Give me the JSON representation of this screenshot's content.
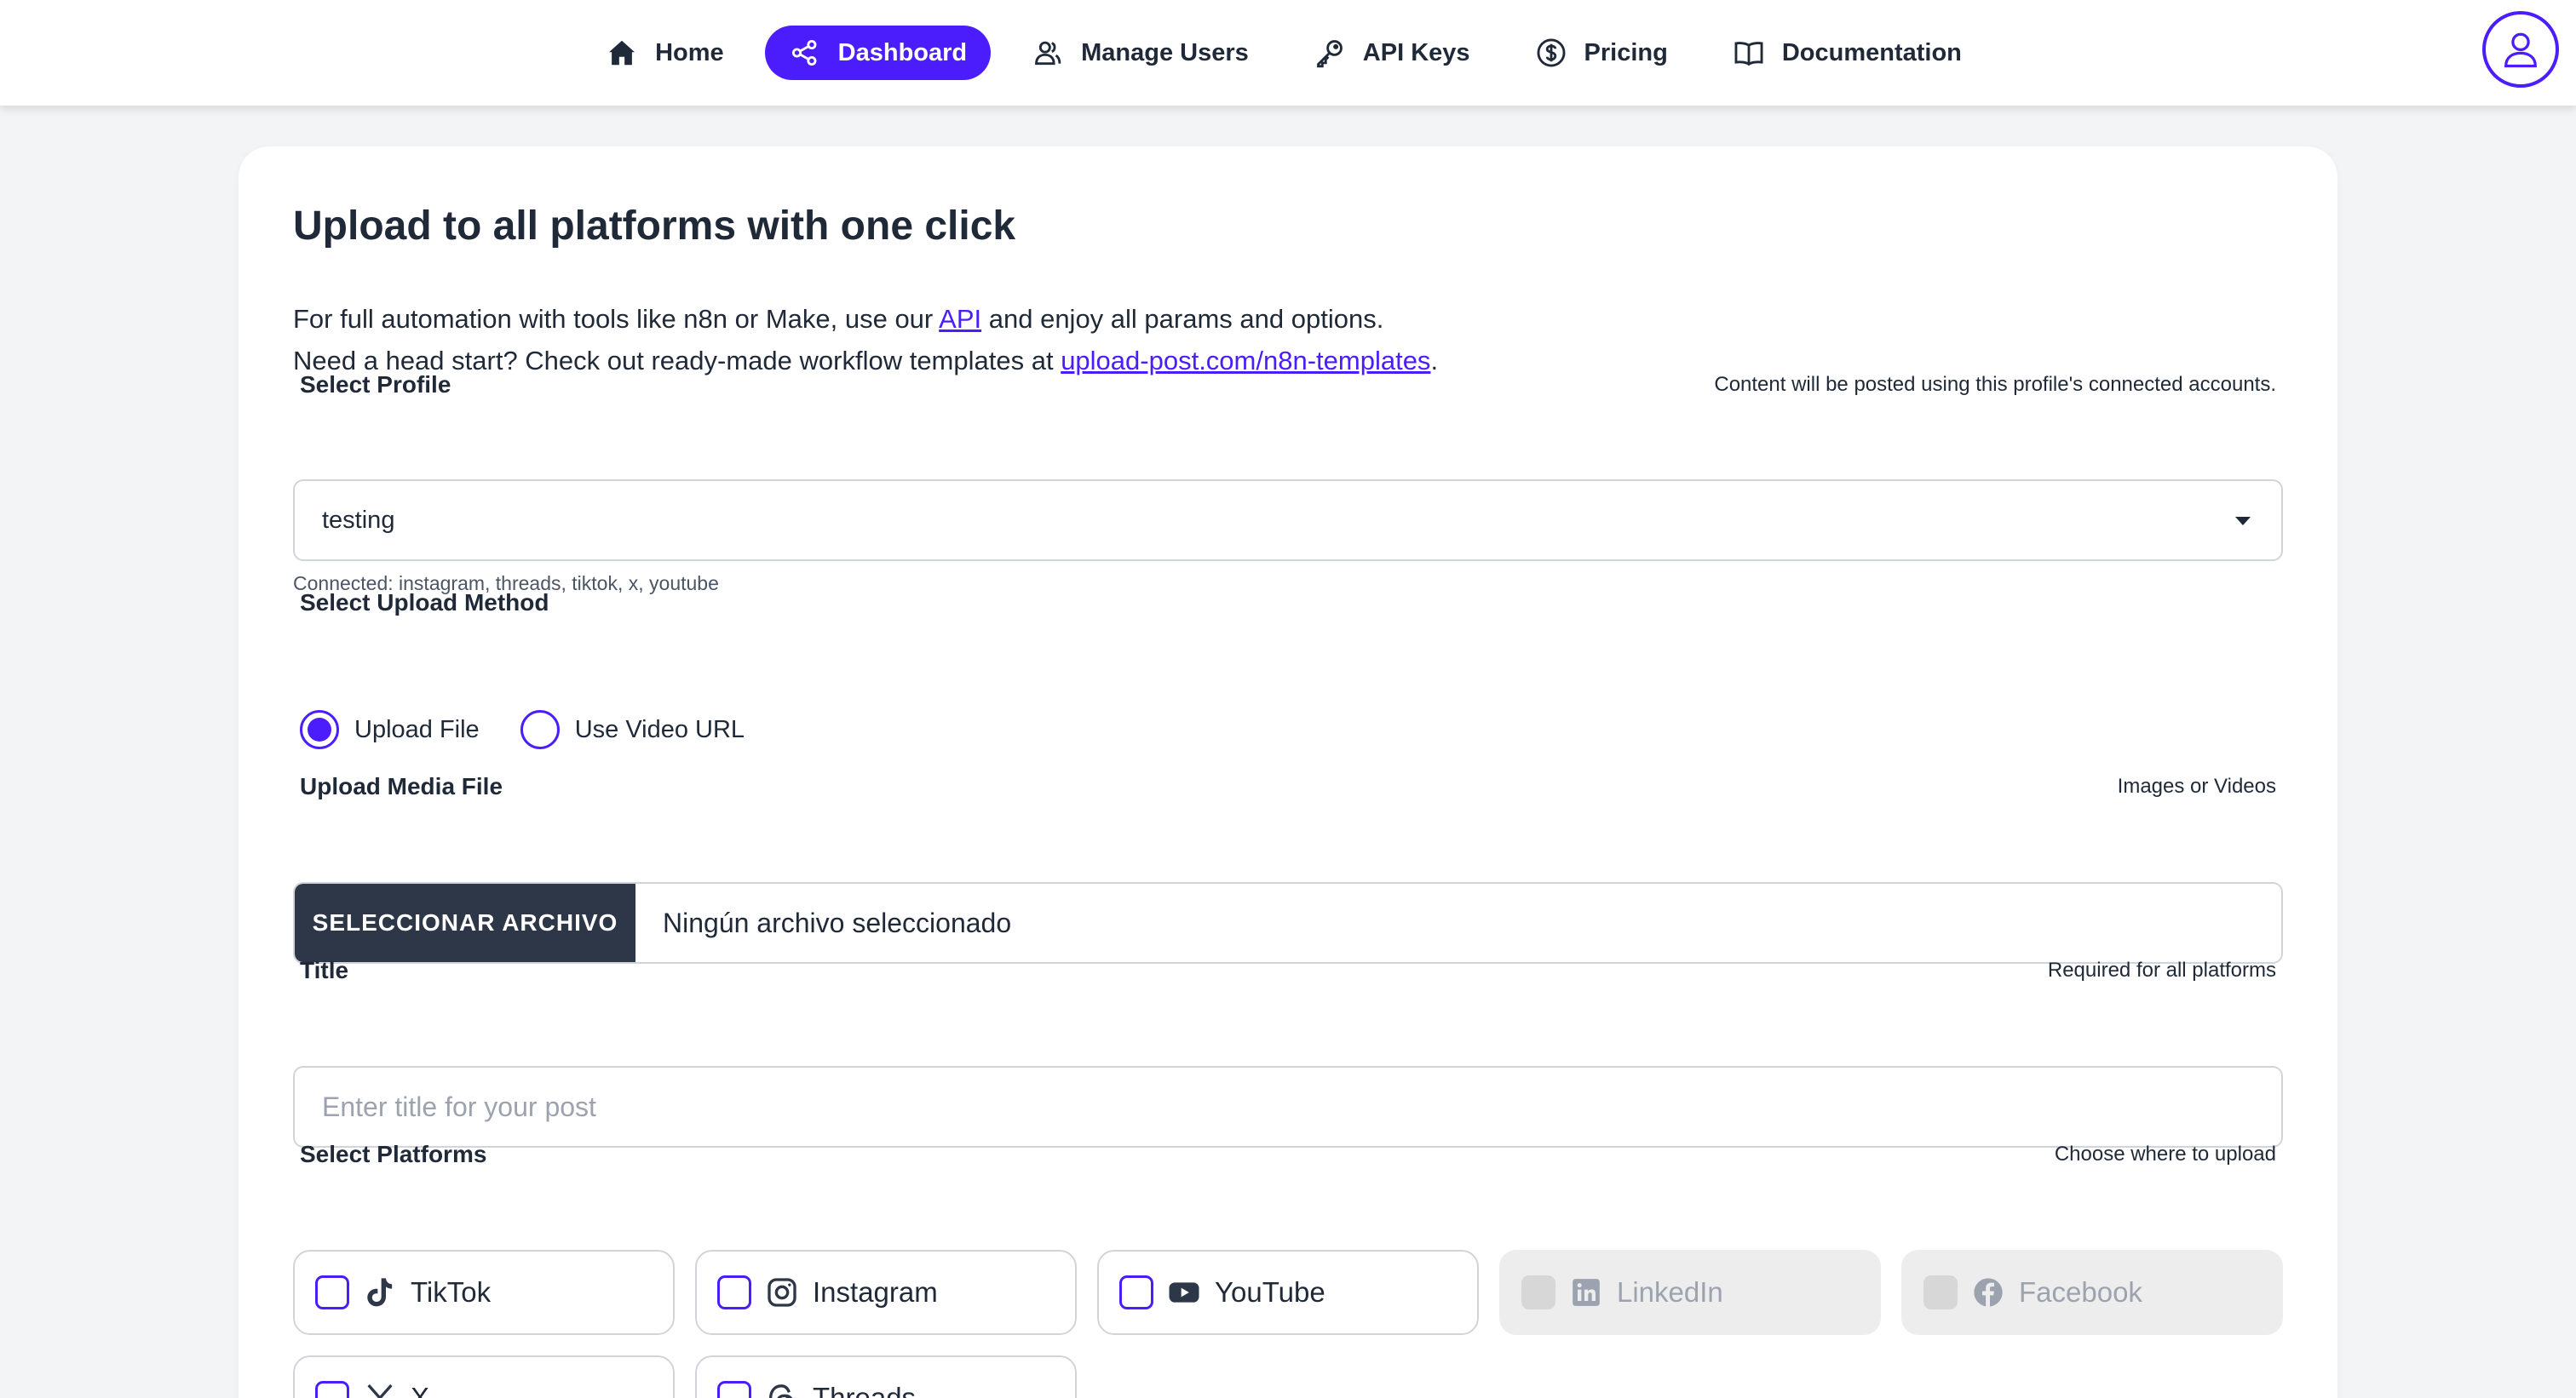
{
  "nav": {
    "items": [
      {
        "label": "Home",
        "icon": "home-icon"
      },
      {
        "label": "Dashboard",
        "icon": "share-icon",
        "active": true
      },
      {
        "label": "Manage Users",
        "icon": "users-icon"
      },
      {
        "label": "API Keys",
        "icon": "key-icon"
      },
      {
        "label": "Pricing",
        "icon": "dollar-icon"
      },
      {
        "label": "Documentation",
        "icon": "book-icon"
      }
    ],
    "avatar_icon": "user-icon"
  },
  "page": {
    "title": "Upload to all platforms with one click",
    "intro_line1_before": "For full automation with tools like n8n or Make, use our ",
    "intro_line1_link": "API",
    "intro_line1_after": " and enjoy all params and options.",
    "intro_line2_before": "Need a head start? Check out ready-made workflow templates at ",
    "intro_line2_link": "upload-post.com/n8n-templates",
    "intro_line2_after": "."
  },
  "profile": {
    "label": "Select Profile",
    "hint": "Content will be posted using this profile's connected accounts.",
    "selected": "testing",
    "connected": "Connected: instagram, threads, tiktok, x, youtube"
  },
  "upload_method": {
    "label": "Select Upload Method",
    "options": [
      {
        "label": "Upload File",
        "selected": true
      },
      {
        "label": "Use Video URL",
        "selected": false
      }
    ]
  },
  "media": {
    "label": "Upload Media File",
    "hint": "Images or Videos",
    "button_label": "SELECCIONAR ARCHIVO",
    "status": "Ningún archivo seleccionado"
  },
  "title_field": {
    "label": "Title",
    "hint": "Required for all platforms",
    "placeholder": "Enter title for your post",
    "value": ""
  },
  "platforms": {
    "label": "Select Platforms",
    "hint": "Choose where to upload",
    "items": [
      {
        "name": "TikTok",
        "icon": "tiktok-icon",
        "disabled": false
      },
      {
        "name": "Instagram",
        "icon": "instagram-icon",
        "disabled": false
      },
      {
        "name": "YouTube",
        "icon": "youtube-icon",
        "disabled": false
      },
      {
        "name": "LinkedIn",
        "icon": "linkedin-icon",
        "disabled": true
      },
      {
        "name": "Facebook",
        "icon": "facebook-icon",
        "disabled": true
      },
      {
        "name": "X",
        "icon": "x-icon",
        "disabled": false
      },
      {
        "name": "Threads",
        "icon": "threads-icon",
        "disabled": false
      }
    ]
  },
  "colors": {
    "accent": "#4c1dfc",
    "dark_button": "#2d3748",
    "background": "#f3f4f6"
  }
}
